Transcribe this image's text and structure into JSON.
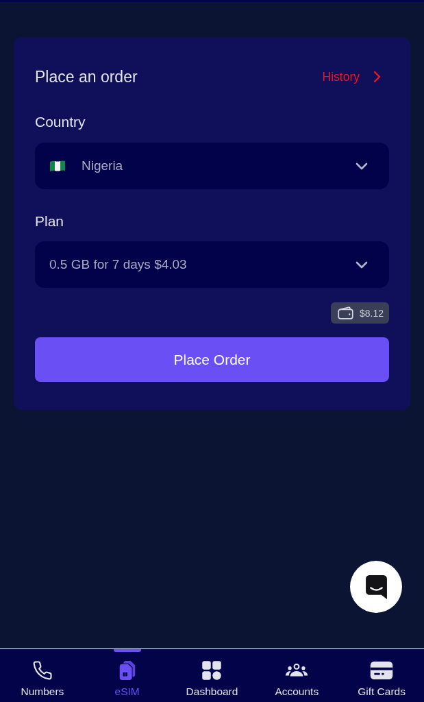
{
  "order_card": {
    "title": "Place an order",
    "history_link": "History"
  },
  "fields": [
    {
      "kind": "country",
      "label": "Country",
      "value": "Nigeria"
    },
    {
      "kind": "plan",
      "label": "Plan",
      "value": "0.5 GB for 7 days $4.03"
    }
  ],
  "wallet": {
    "balance": "$8.12"
  },
  "primary_button": "Place Order",
  "bottom_nav": {
    "items": [
      {
        "label": "Numbers",
        "selected": false
      },
      {
        "label": "eSIM",
        "selected": true
      },
      {
        "label": "Dashboard",
        "selected": false
      },
      {
        "label": "Accounts",
        "selected": false
      },
      {
        "label": "Gift Cards",
        "selected": false
      }
    ]
  }
}
